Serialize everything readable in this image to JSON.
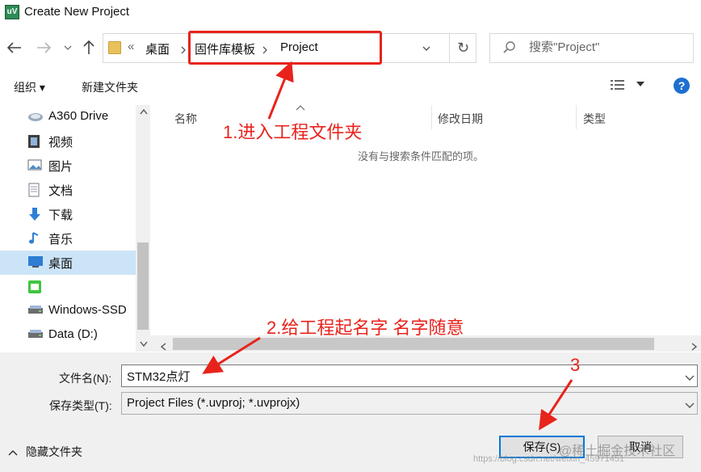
{
  "window": {
    "title": "Create New Project",
    "app_icon": "uV"
  },
  "address": {
    "overflow": "«",
    "crumbs": [
      "桌面",
      "固件库模板",
      "Project"
    ],
    "refresh_glyph": "↻"
  },
  "search": {
    "placeholder": "搜索\"Project\""
  },
  "toolbar": {
    "organize": "组织 ▾",
    "new_folder": "新建文件夹",
    "help": "?"
  },
  "nav": {
    "items": [
      {
        "label": "A360 Drive",
        "icon": "cloud-drive-icon"
      },
      {
        "label": "视频",
        "icon": "video-icon"
      },
      {
        "label": "图片",
        "icon": "pictures-icon"
      },
      {
        "label": "文档",
        "icon": "documents-icon"
      },
      {
        "label": "下载",
        "icon": "download-icon"
      },
      {
        "label": "音乐",
        "icon": "music-icon"
      },
      {
        "label": "桌面",
        "icon": "desktop-icon",
        "selected": true
      },
      {
        "label": "",
        "icon": "app-icon"
      },
      {
        "label": "Windows-SSD",
        "icon": "drive-icon"
      },
      {
        "label": "Data (D:)",
        "icon": "drive-icon"
      }
    ]
  },
  "filelist": {
    "columns": [
      "名称",
      "修改日期",
      "类型"
    ],
    "empty_message": "没有与搜索条件匹配的项。"
  },
  "form": {
    "filename_label": "文件名(N):",
    "filename_value": "STM32点灯",
    "filetype_label": "保存类型(T):",
    "filetype_value": "Project Files (*.uvproj; *.uvprojx)",
    "hide_folders": "隐藏文件夹",
    "save": "保存(S)",
    "cancel": "取消"
  },
  "annotations": {
    "step1": "1.进入工程文件夹",
    "step2": "2.给工程起名字 名字随意",
    "step3": "3",
    "color": "#e8231c"
  },
  "watermarks": {
    "url": "https://blog.csdn.net/weixin_45971451",
    "site": "@稀土掘金技术社区"
  }
}
